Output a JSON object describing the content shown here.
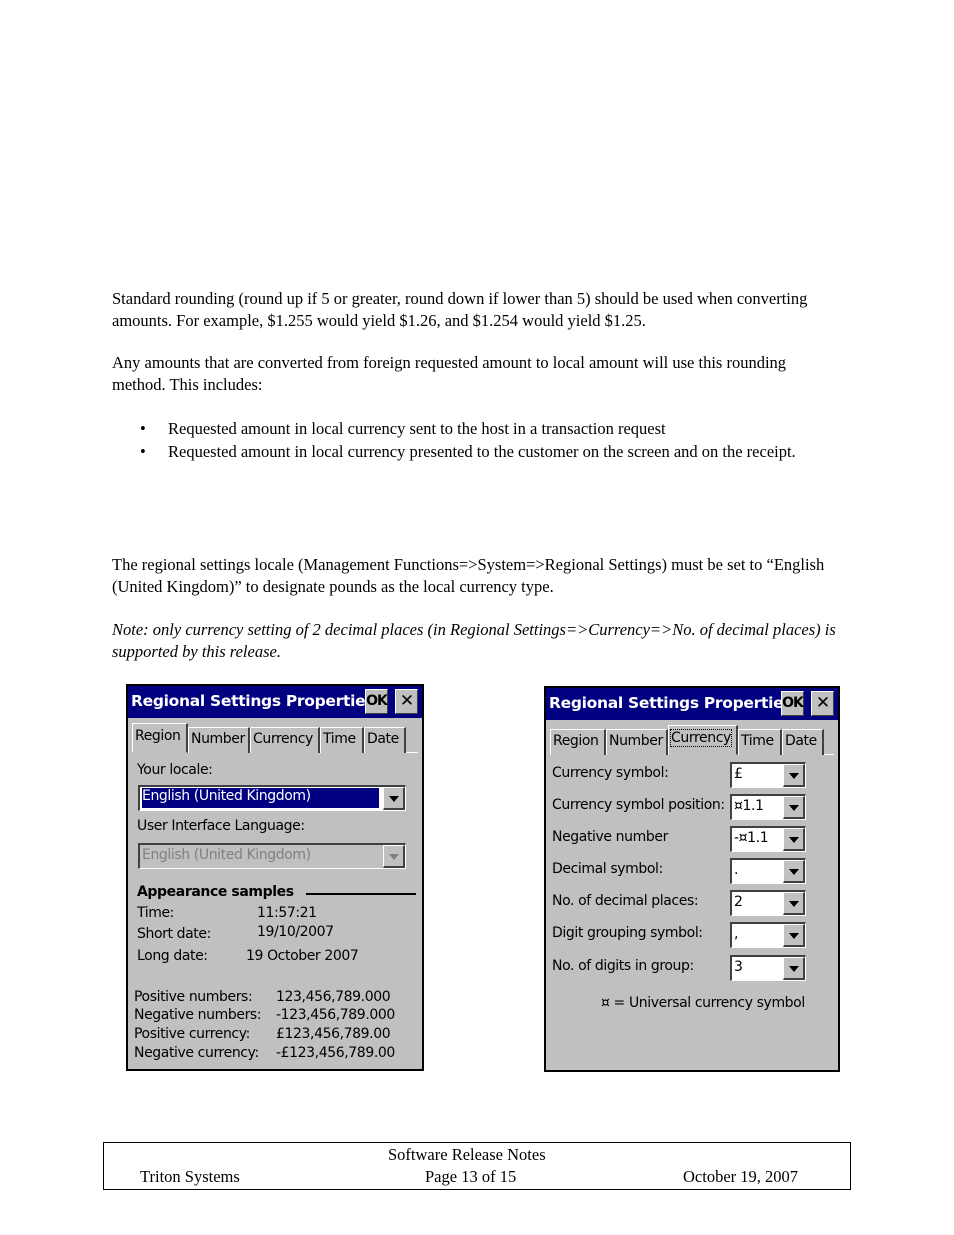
{
  "body": {
    "paragraph_1": "Standard rounding (round up if 5 or greater, round down if lower than 5) should be used when converting amounts.  For example, $1.255 would yield $1.26, and $1.254 would yield $1.25.",
    "paragraph_2": "Any amounts that are converted from foreign requested amount to local amount will use this rounding method.  This includes:",
    "bullets": [
      "Requested amount in local currency sent to the host in a transaction request",
      "Requested amount in local currency presented  to the customer on the screen and on the receipt."
    ],
    "bullet_glyph": "•",
    "paragraph_3": "The regional settings locale (Management Functions=>System=>Regional Settings) must be set to “English (United Kingdom)” to designate pounds as the local currency type.",
    "note": "Note: only currency setting of 2 decimal places (in Regional Settings=>Currency=>No. of decimal places) is supported by this release."
  },
  "dialog_region": {
    "title": "Regional Settings Properties",
    "ok_label": "OK",
    "close_glyph": "✕",
    "tabs": [
      "Region",
      "Number",
      "Currency",
      "Time",
      "Date"
    ],
    "active_tab": "Region",
    "your_locale_label": "Your locale:",
    "your_locale_value": "English (United Kingdom)",
    "ui_language_label": "User Interface Language:",
    "ui_language_value": "English (United Kingdom)",
    "appearance_title": "Appearance samples",
    "samples": [
      {
        "label": "Time:",
        "value": "11:57:21"
      },
      {
        "label": "Short date:",
        "value": "19/10/2007"
      },
      {
        "label": "Long date:",
        "value": "19 October 2007"
      }
    ],
    "number_samples": [
      {
        "label": "Positive numbers:",
        "value": "123,456,789.000"
      },
      {
        "label": "Negative numbers:",
        "value": "-123,456,789.000"
      },
      {
        "label": "Positive currency:",
        "value": "£123,456,789.00"
      },
      {
        "label": "Negative currency:",
        "value": "-£123,456,789.00"
      }
    ]
  },
  "dialog_currency": {
    "title": "Regional Settings Properties",
    "ok_label": "OK",
    "close_glyph": "✕",
    "tabs": [
      "Region",
      "Number",
      "Currency",
      "Time",
      "Date"
    ],
    "active_tab": "Currency",
    "fields": [
      {
        "label": "Currency symbol:",
        "value": "£"
      },
      {
        "label": "Currency symbol position:",
        "value": "¤1.1"
      },
      {
        "label": "Negative number",
        "value": "-¤1.1"
      },
      {
        "label": "Decimal symbol:",
        "value": "."
      },
      {
        "label": "No. of decimal places:",
        "value": "2"
      },
      {
        "label": "Digit grouping symbol:",
        "value": ","
      },
      {
        "label": "No. of digits in group:",
        "value": "3"
      }
    ],
    "legend": "¤ = Universal currency symbol"
  },
  "footer": {
    "company": "Triton Systems",
    "doc_title": "Software Release Notes",
    "page": "Page 13 of 15",
    "date": "October 19, 2007"
  },
  "colors": {
    "titlebar": "#000080",
    "dialog_bg": "#c0c0c0",
    "selection": "#000080"
  }
}
